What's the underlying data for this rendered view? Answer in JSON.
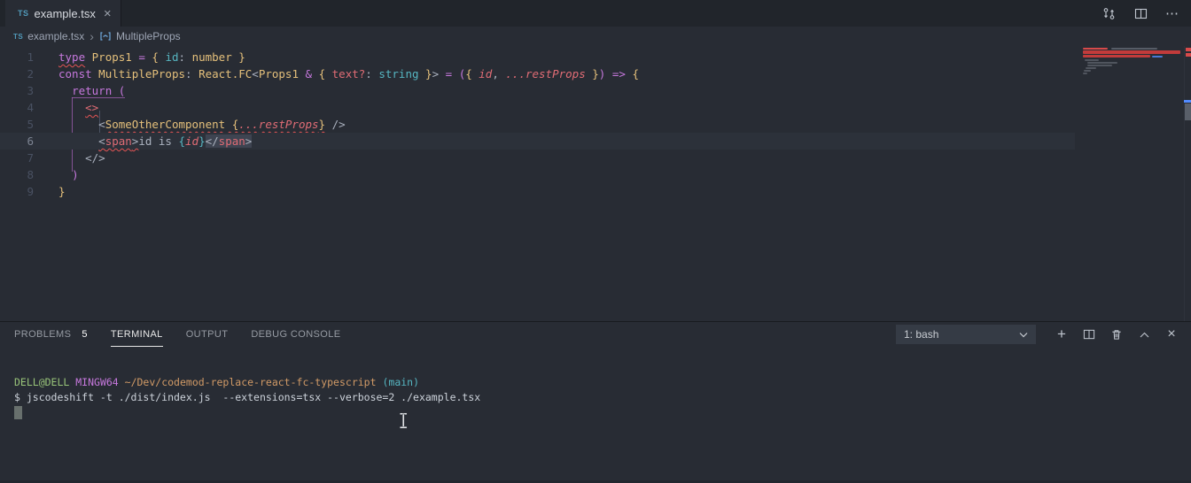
{
  "colors": {
    "fg": "#abb2bf",
    "purple": "#c678dd",
    "gold": "#e5c07b",
    "red": "#e06c75",
    "cyan": "#56b6c2",
    "orange": "#d19a66",
    "tfg": "#ccd2da",
    "tgreen": "#98c379",
    "tmagenta": "#c678dd",
    "tyellow": "#d19a66",
    "tcyan": "#56b6c2"
  },
  "glyphs": {
    "close": "×",
    "more": "⋯",
    "add": "+",
    "chevronRight": "›"
  },
  "tab": {
    "icon": "TS",
    "title": "example.tsx"
  },
  "breadcrumb": {
    "file": "example.tsx",
    "symbol": "MultipleProps"
  },
  "editor": {
    "lines": [
      {
        "num": "1",
        "tokens": [
          {
            "t": "type",
            "c": "purple",
            "sq": true
          },
          {
            "t": " "
          },
          {
            "t": "Props1",
            "c": "gold"
          },
          {
            "t": " "
          },
          {
            "t": "=",
            "c": "purple"
          },
          {
            "t": " "
          },
          {
            "t": "{",
            "c": "gold"
          },
          {
            "t": " "
          },
          {
            "t": "id",
            "c": "cyan"
          },
          {
            "t": ": "
          },
          {
            "t": "number",
            "c": "gold"
          },
          {
            "t": " "
          },
          {
            "t": "}",
            "c": "gold"
          }
        ]
      },
      {
        "num": "2",
        "tokens": [
          {
            "t": "const",
            "c": "purple"
          },
          {
            "t": " "
          },
          {
            "t": "MultipleProps",
            "c": "gold"
          },
          {
            "t": ": "
          },
          {
            "t": "React.FC",
            "c": "gold"
          },
          {
            "t": "<"
          },
          {
            "t": "Props1",
            "c": "gold"
          },
          {
            "t": " "
          },
          {
            "t": "&",
            "c": "purple"
          },
          {
            "t": " "
          },
          {
            "t": "{",
            "c": "gold"
          },
          {
            "t": " "
          },
          {
            "t": "text?",
            "c": "red"
          },
          {
            "t": ": "
          },
          {
            "t": "string",
            "c": "cyan"
          },
          {
            "t": " "
          },
          {
            "t": "}",
            "c": "gold"
          },
          {
            "t": ">"
          },
          {
            "t": " "
          },
          {
            "t": "=",
            "c": "purple"
          },
          {
            "t": " "
          },
          {
            "t": "(",
            "c": "purple"
          },
          {
            "t": "{",
            "c": "gold"
          },
          {
            "t": " "
          },
          {
            "t": "id",
            "c": "red",
            "i": true
          },
          {
            "t": ", "
          },
          {
            "t": "...",
            "c": "red",
            "i": true
          },
          {
            "t": "restProps",
            "c": "red",
            "i": true
          },
          {
            "t": " "
          },
          {
            "t": "}",
            "c": "gold"
          },
          {
            "t": ")",
            "c": "purple"
          },
          {
            "t": " "
          },
          {
            "t": "=>",
            "c": "purple"
          },
          {
            "t": " "
          },
          {
            "t": "{",
            "c": "gold"
          }
        ]
      },
      {
        "num": "3",
        "tokens": [
          {
            "t": "  "
          },
          {
            "t": "return",
            "c": "purple"
          },
          {
            "t": " "
          },
          {
            "t": "(",
            "c": "purple"
          }
        ]
      },
      {
        "num": "4",
        "tokens": [
          {
            "t": "    "
          },
          {
            "t": "<>",
            "c": "red",
            "sq": true
          }
        ]
      },
      {
        "num": "5",
        "tokens": [
          {
            "t": "      "
          },
          {
            "t": "<"
          },
          {
            "t": "SomeOtherComponent",
            "c": "gold",
            "sq": true
          },
          {
            "t": " ",
            "sq": true
          },
          {
            "t": "{",
            "c": "gold",
            "sq": true
          },
          {
            "t": "...",
            "c": "red",
            "i": true,
            "sq": true
          },
          {
            "t": "restProps",
            "c": "red",
            "i": true,
            "sq": true
          },
          {
            "t": "}",
            "c": "gold",
            "sq": true
          },
          {
            "t": " "
          },
          {
            "t": "/>"
          }
        ]
      },
      {
        "num": "6",
        "current": true,
        "tokens": [
          {
            "t": "      "
          },
          {
            "t": "<",
            "sq": true
          },
          {
            "t": "span",
            "c": "red",
            "sq": true
          },
          {
            "t": ">",
            "sq": true
          },
          {
            "t": "id is "
          },
          {
            "t": "{",
            "c": "cyan"
          },
          {
            "t": "id",
            "c": "red",
            "i": true
          },
          {
            "t": "}",
            "c": "cyan"
          },
          {
            "t": "</",
            "hl": true
          },
          {
            "t": "span",
            "c": "red",
            "hl": true
          },
          {
            "t": ">",
            "hl": true
          }
        ]
      },
      {
        "num": "7",
        "tokens": [
          {
            "t": "    "
          },
          {
            "t": "</>"
          }
        ]
      },
      {
        "num": "8",
        "tokens": [
          {
            "t": "  "
          },
          {
            "t": ")",
            "c": "purple"
          }
        ]
      },
      {
        "num": "9",
        "tokens": [
          {
            "t": "}",
            "c": "gold"
          }
        ]
      }
    ]
  },
  "panel": {
    "tabs": [
      {
        "label": "PROBLEMS",
        "badge": "5"
      },
      {
        "label": "TERMINAL",
        "active": true
      },
      {
        "label": "OUTPUT"
      },
      {
        "label": "DEBUG CONSOLE"
      }
    ],
    "picker": "1: bash"
  },
  "terminal": {
    "lines": [
      {
        "tokens": [
          {
            "t": "DELL@DELL",
            "c": "tgreen"
          },
          {
            "t": " ",
            "c": "tfg"
          },
          {
            "t": "MINGW64",
            "c": "tmagenta"
          },
          {
            "t": " ",
            "c": "tfg"
          },
          {
            "t": "~/Dev/codemod-replace-react-fc-typescript",
            "c": "tyellow"
          },
          {
            "t": " ",
            "c": "tfg"
          },
          {
            "t": "(main)",
            "c": "tcyan"
          }
        ]
      },
      {
        "tokens": [
          {
            "t": "$ jscodeshift -t ./dist/index.js  --extensions=tsx --verbose=2 ./example.tsx",
            "c": "tfg"
          }
        ]
      }
    ]
  }
}
